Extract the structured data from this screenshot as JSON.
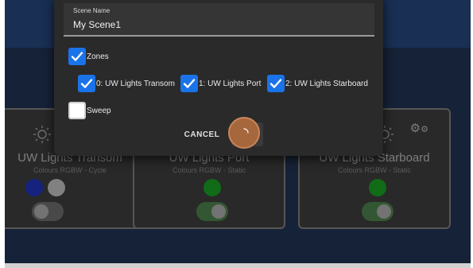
{
  "dialog": {
    "field_label": "Scene Name",
    "scene_name": "My Scene1",
    "zones_label": "Zones",
    "zone_options": [
      {
        "label": "0: UW Lights Transom",
        "checked": true
      },
      {
        "label": "1: UW Lights Port",
        "checked": true
      },
      {
        "label": "2: UW Lights Starboard",
        "checked": true
      }
    ],
    "sweep_label": "Sweep",
    "sweep_checked": false,
    "cancel_label": "CANCEL"
  },
  "cards": [
    {
      "title": "UW Lights Transom",
      "subtitle": "Colours RGBW - Cycle",
      "colors": [
        "#1a2a9a",
        "#9e9e9e"
      ],
      "toggle_on": false
    },
    {
      "title": "UW Lights Port",
      "subtitle": "Colours RGBW - Static",
      "colors": [
        "#14841c"
      ],
      "toggle_on": true
    },
    {
      "title": "UW Lights Starboard",
      "subtitle": "Colours RGBW - Static",
      "colors": [
        "#14841c"
      ],
      "toggle_on": true
    }
  ],
  "icons": {
    "sun": "sun-icon",
    "gear": "gear-icon",
    "check": "check-icon",
    "spinner": "loading-spinner-icon"
  },
  "colors": {
    "checkbox_accent": "#1a73e8",
    "toggle_on_track": "#3f6b3f",
    "toggle_off_track": "#5a5a5a",
    "spinner": "#a6673d"
  }
}
